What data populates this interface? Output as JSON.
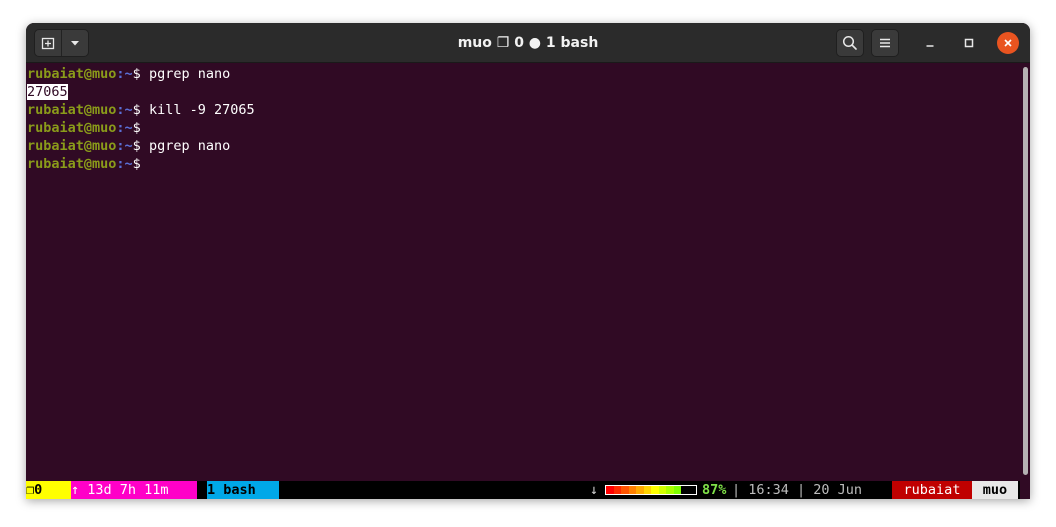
{
  "window": {
    "title": "muo ❐ 0 ● 1 bash"
  },
  "titlebar": {
    "new_tab_icon": "new-tab-icon",
    "dropdown_icon": "chevron-down-icon",
    "search_icon": "search-icon",
    "menu_icon": "hamburger-menu-icon",
    "minimize_icon": "minimize-icon",
    "maximize_icon": "maximize-icon",
    "close_icon": "close-icon",
    "close_color": "#e95420"
  },
  "terminal": {
    "background": "#300a24",
    "user_host": "rubaiat@muo",
    "path": ":~",
    "prompt_symbol": "$",
    "lines": [
      {
        "kind": "prompt",
        "command": " pgrep nano"
      },
      {
        "kind": "output",
        "text": "27065"
      },
      {
        "kind": "prompt",
        "command": " kill -9 27065"
      },
      {
        "kind": "prompt",
        "command": ""
      },
      {
        "kind": "prompt",
        "command": " pgrep nano"
      },
      {
        "kind": "prompt",
        "command": ""
      }
    ]
  },
  "statusbar": {
    "window_segment": "❐0",
    "uptime": "↑ 13d 7h 11m",
    "active_window": "1 bash",
    "download_arrow": "↓",
    "battery_percent": "87%",
    "battery_level": 0.87,
    "time_date": "| 16:34 | 20 Jun",
    "user": "rubaiat",
    "host": "muo"
  }
}
